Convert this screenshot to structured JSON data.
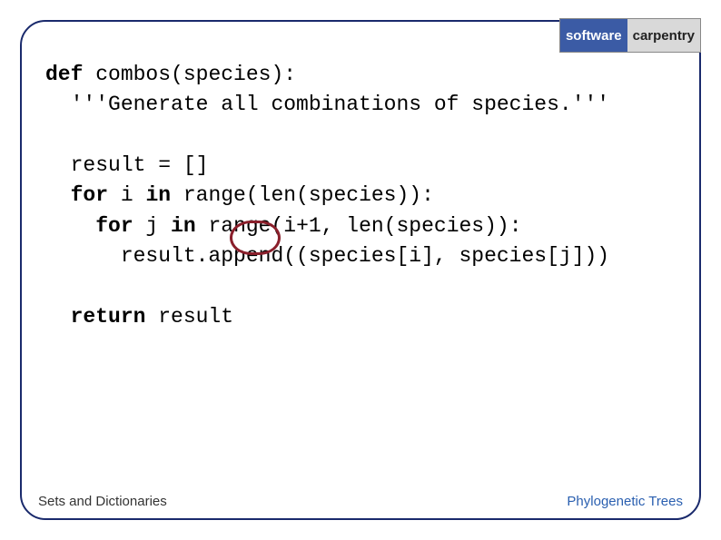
{
  "logo": {
    "left_main": "software",
    "left_sub": "",
    "right": "carpentry"
  },
  "code": {
    "l1_def": "def",
    "l1_rest": " combos(species):",
    "l2": "  '''Generate all combinations of species.'''",
    "l3": "",
    "l4": "  result = []",
    "l5_for": "  for",
    "l5_mid": " i ",
    "l5_in": "in",
    "l5_rest": " range(len(species)):",
    "l6_for": "    for",
    "l6_mid": " j ",
    "l6_in": "in",
    "l6_rest": " range(i+1, len(species)):",
    "l7": "      result.append((species[i], species[j]))",
    "l8": "",
    "l9_ret": "  return",
    "l9_rest": " result"
  },
  "highlight": {
    "target": "i+1"
  },
  "footer": {
    "left": "Sets and Dictionaries",
    "right": "Phylogenetic Trees"
  }
}
